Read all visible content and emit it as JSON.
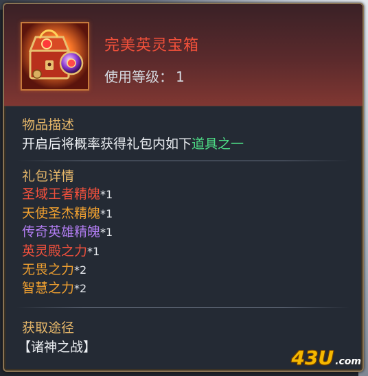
{
  "item": {
    "name": "完美英灵宝箱",
    "use_level_label": "使用等级：",
    "use_level_value": "1",
    "icon": "treasure-chest-icon"
  },
  "description": {
    "label": "物品描述",
    "text": "开启后将概率获得礼包内如下",
    "highlight": "道具之一"
  },
  "gift_details": {
    "label": "礼包详情",
    "items": [
      {
        "name": "圣域王者精魄",
        "qty": "*1",
        "color": "#f0503c"
      },
      {
        "name": "天使圣杰精魄",
        "qty": "*1",
        "color": "#f0a030"
      },
      {
        "name": "传奇英雄精魄",
        "qty": "*1",
        "color": "#b07cf0"
      },
      {
        "name": "英灵殿之力",
        "qty": "*1",
        "color": "#f0503c"
      },
      {
        "name": "无畏之力",
        "qty": "*2",
        "color": "#f0a030"
      },
      {
        "name": "智慧之力",
        "qty": "*2",
        "color": "#f0a030"
      }
    ]
  },
  "source": {
    "label": "获取途径",
    "value": "【诸神之战】"
  },
  "watermark": {
    "main": "43U",
    "suffix": ".com"
  },
  "colors": {
    "title": "#f2503a",
    "section_label": "#e7b86a",
    "highlight": "#4ddd86"
  }
}
